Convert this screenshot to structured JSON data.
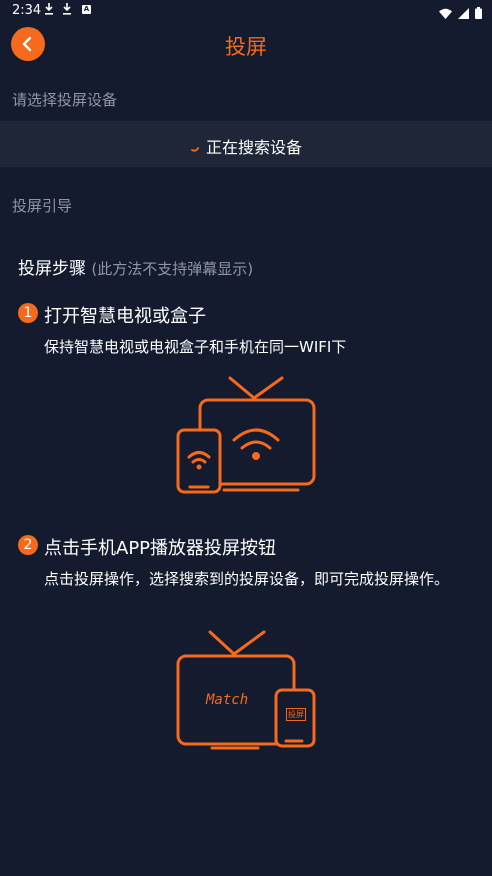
{
  "status_bar": {
    "time": "2:34",
    "left_icons": [
      "download-icon",
      "download-icon",
      "app-notification-icon"
    ],
    "right_icons": [
      "wifi-icon",
      "signal-icon",
      "battery-icon"
    ]
  },
  "header": {
    "back_icon": "chevron-left-icon",
    "title": "投屏"
  },
  "select_device": {
    "label": "请选择投屏设备",
    "searching_text": "正在搜索设备",
    "spinner_icon": "loading-spinner-icon"
  },
  "guide": {
    "label": "投屏引导",
    "title": "投屏步骤",
    "note": "(此方法不支持弹幕显示)",
    "steps": [
      {
        "number": "1",
        "title": "打开智慧电视或盒子",
        "description": "保持智慧电视或电视盒子和手机在同一WIFI下",
        "illustration": "tv-phone-wifi-illustration"
      },
      {
        "number": "2",
        "title": "点击手机APP播放器投屏按钮",
        "description": "点击投屏操作，选择搜索到的投屏设备，即可完成投屏操作。",
        "illustration": "tv-phone-cast-illustration",
        "tv_screen_text": "Match",
        "phone_screen_text": "投屏"
      }
    ]
  },
  "colors": {
    "background": "#141b2e",
    "accent": "#f56a1c",
    "search_row": "#1e2637",
    "muted_text": "#8f95a3"
  }
}
